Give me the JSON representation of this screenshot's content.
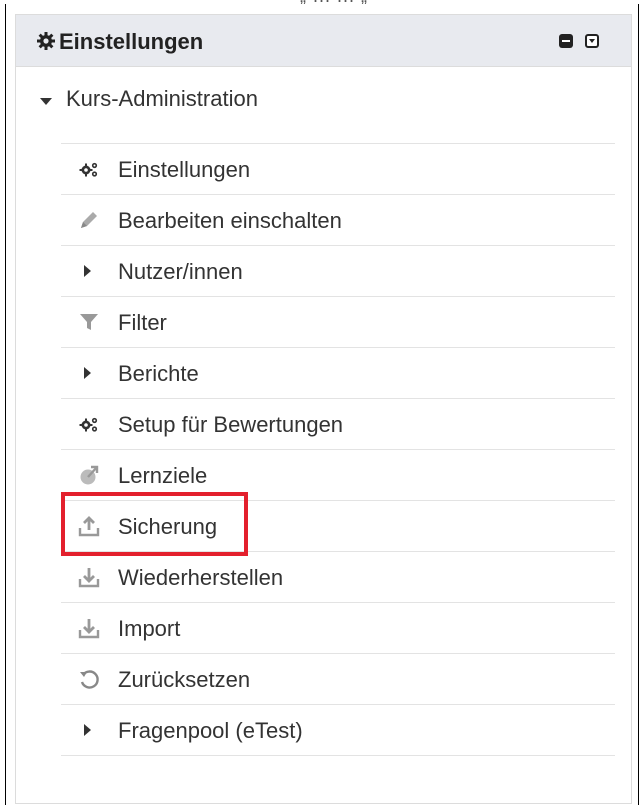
{
  "page_caption_fragment": "„ ... ... „",
  "block": {
    "title": "Einstellungen",
    "gear_icon": "gear-icon",
    "minimize_icon": "minus-square-icon",
    "collapse_icon": "caret-down-square-icon"
  },
  "section": {
    "label": "Kurs-Administration",
    "expanded": true
  },
  "items": [
    {
      "label": "Einstellungen",
      "icon": "gears-icon",
      "expandable": false
    },
    {
      "label": "Bearbeiten einschalten",
      "icon": "pencil-icon",
      "expandable": false
    },
    {
      "label": "Nutzer/innen",
      "icon": "caret-right-icon",
      "expandable": true
    },
    {
      "label": "Filter",
      "icon": "filter-icon",
      "expandable": false
    },
    {
      "label": "Berichte",
      "icon": "caret-right-icon",
      "expandable": true
    },
    {
      "label": "Setup für Bewertungen",
      "icon": "gears-icon",
      "expandable": false
    },
    {
      "label": "Lernziele",
      "icon": "target-icon",
      "expandable": false
    },
    {
      "label": "Sicherung",
      "icon": "upload-icon",
      "expandable": false,
      "highlighted": true
    },
    {
      "label": "Wiederherstellen",
      "icon": "download-icon",
      "expandable": false
    },
    {
      "label": "Import",
      "icon": "download-icon",
      "expandable": false
    },
    {
      "label": "Zurücksetzen",
      "icon": "reset-icon",
      "expandable": false
    },
    {
      "label": "Fragenpool (eTest)",
      "icon": "caret-right-icon",
      "expandable": true
    }
  ],
  "colors": {
    "header_bg": "#e8eaef",
    "highlight": "#e3202d",
    "icon_grey": "#aaaaaa",
    "text": "#333333"
  }
}
